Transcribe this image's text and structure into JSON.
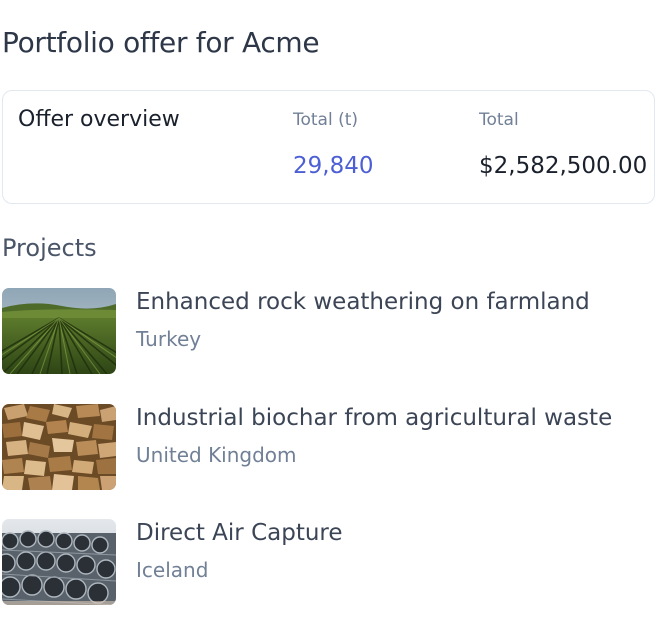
{
  "page": {
    "title": "Portfolio offer for Acme"
  },
  "overview": {
    "title": "Offer overview",
    "tonnes_label": "Total (t)",
    "tonnes_value": "29,840",
    "total_label": "Total",
    "total_value": "$2,582,500.00",
    "accent_color": "#4c5fd5"
  },
  "projects": {
    "title": "Projects",
    "items": [
      {
        "name": "Enhanced rock weathering on farmland",
        "country": "Turkey",
        "image": "farmland-photo"
      },
      {
        "name": "Industrial biochar from agricultural waste",
        "country": "United Kingdom",
        "image": "wood-chips-photo"
      },
      {
        "name": "Direct Air Capture",
        "country": "Iceland",
        "image": "air-capture-fans-photo"
      }
    ]
  }
}
